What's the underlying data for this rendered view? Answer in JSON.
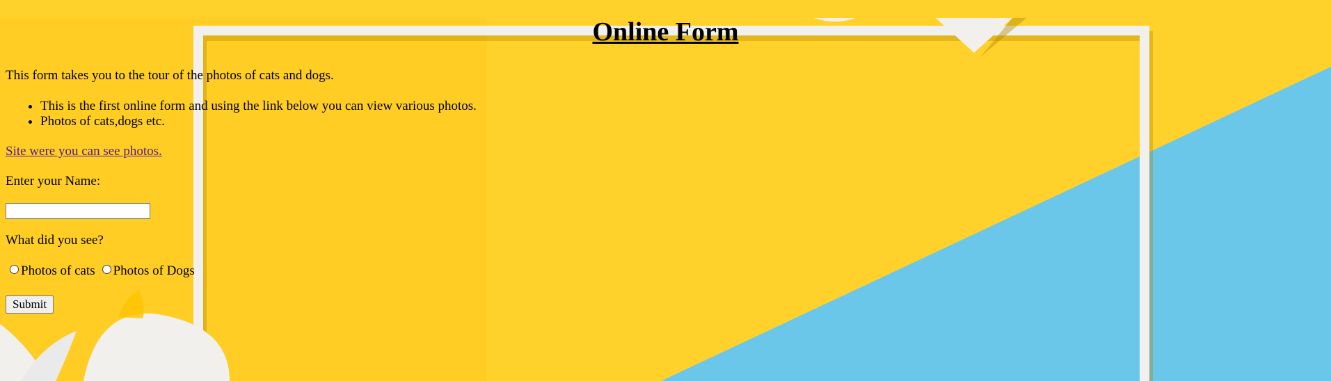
{
  "page": {
    "title": "Online Form",
    "intro": "This form takes you to the tour of the photos of cats and dogs.",
    "bullets": [
      "This is the first online form and using the link below you can view various photos.",
      "Photos of cats,dogs etc."
    ],
    "link_text": "Site were you can see photos.",
    "name_label": "Enter your Name:",
    "name_value": "",
    "question": "What did you see?",
    "radio_options": [
      "Photos of cats",
      "Photos of Dogs"
    ],
    "submit_label": "Submit"
  },
  "colors": {
    "background_yellow": "#ffd12a",
    "background_blue": "#6ac7ea",
    "frame_white": "#f1f0ec",
    "link_visited": "#551a8b"
  }
}
